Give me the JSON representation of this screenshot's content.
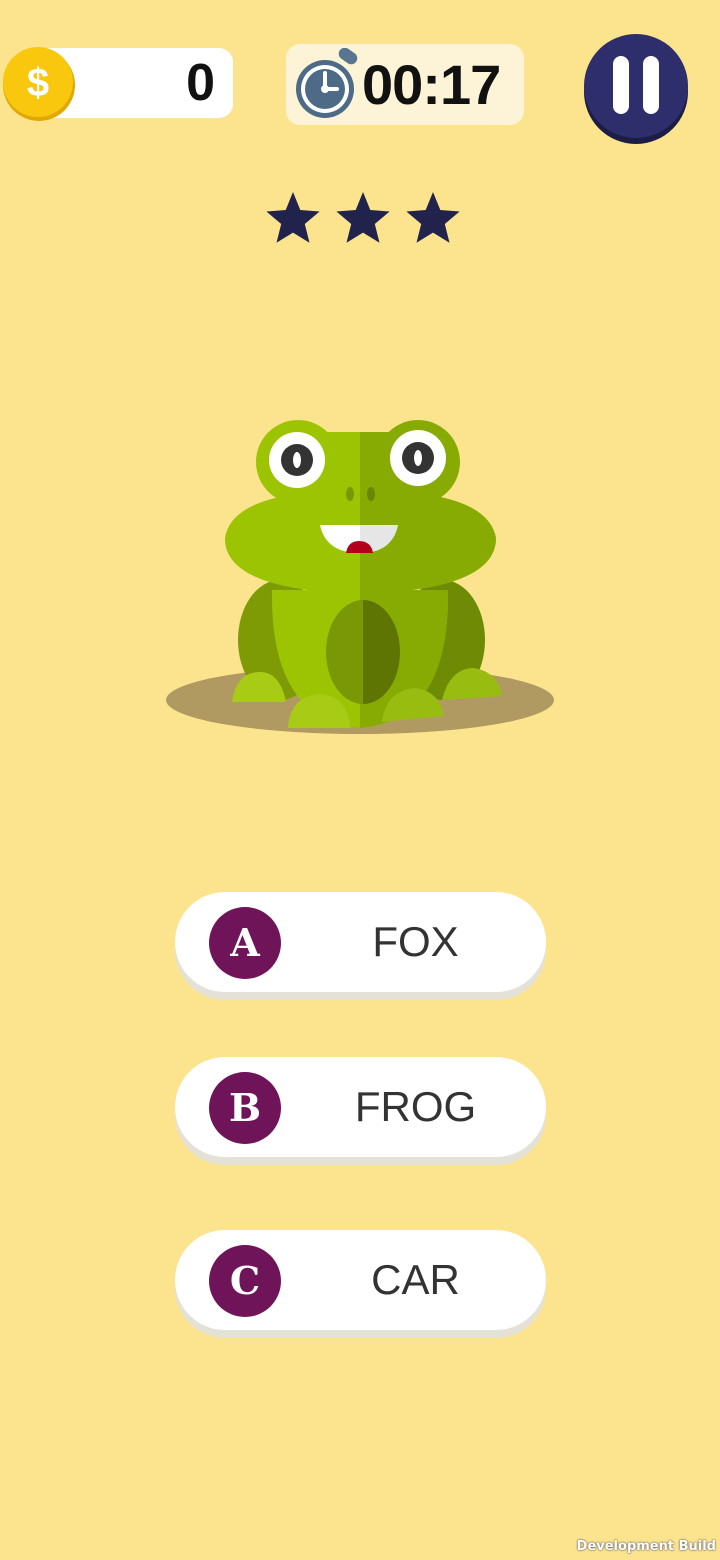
{
  "hud": {
    "coins": "0",
    "coin_symbol": "$",
    "timer": "00:17"
  },
  "stars": {
    "earned": 3,
    "total": 3
  },
  "question": {
    "picture_icon": "frog-icon"
  },
  "answers": [
    {
      "letter": "A",
      "label": "FOX"
    },
    {
      "letter": "B",
      "label": "FROG"
    },
    {
      "letter": "C",
      "label": "CAR"
    }
  ],
  "footer": {
    "build_label": "Development Build"
  },
  "colors": {
    "background": "#fce48f",
    "letter_badge": "#6f1458",
    "pause_button": "#2d2e6b",
    "star": "#22234d",
    "coin": "#f9c80e"
  }
}
